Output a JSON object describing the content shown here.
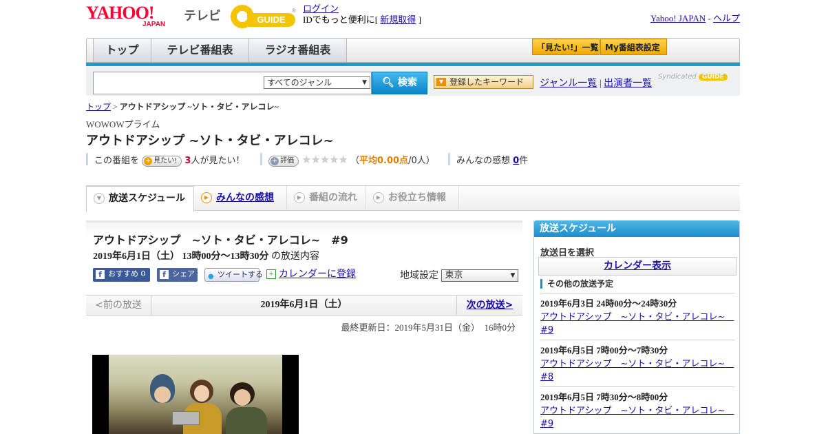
{
  "header": {
    "yahoo_logo": "YAHOO!",
    "yahoo_japan": "JAPAN",
    "tv_label": "テレビ",
    "gguide_label": "GUIDE",
    "gguide_reg": "®",
    "login_link": "ログイン",
    "login_text": "IDでもっと便利に[",
    "signup_link": "新規取得",
    "login_close": "]",
    "yahoo_japan_link": "Yahoo! JAPAN",
    "help_sep": "-",
    "help_link": "ヘルプ"
  },
  "nav": {
    "tabs": [
      {
        "label": "トップ"
      },
      {
        "label": "テレビ番組表"
      },
      {
        "label": "ラジオ番組表"
      }
    ],
    "want_list_button": "「見たい!」一覧",
    "my_schedule_button": "My番組表設定"
  },
  "search": {
    "genre_selected": "すべてのジャンル",
    "button_label": "検索",
    "keyword_button": "登録したキーワード",
    "genre_list_link": "ジャンル一覧",
    "link_sep": "|",
    "performer_list_link": "出演者一覧",
    "syndicated_label": "Syndicated",
    "syndicated_brand": "GUIDE"
  },
  "breadcrumb": {
    "home": "トップ",
    "sep": ">",
    "current": "アウトドアシップ ~ソト・タビ・アレコレ~"
  },
  "program": {
    "channel": "WOWOWプライム",
    "title": "アウトドアシップ ~ソト・タビ・アレコレ~",
    "this_program": "この番組を",
    "want_button": "見たい!",
    "want_count": "3",
    "want_suffix": "人が見たい！",
    "rate_button": "評価",
    "stars": "★★★★★",
    "avg_open": "（",
    "avg_label": "平均0.00点",
    "avg_people": "/0人）",
    "impressions_label": "みんなの感想",
    "impressions_count": "0",
    "impressions_suffix": "件"
  },
  "content_tabs": [
    {
      "label": "放送スケジュール"
    },
    {
      "label": "みんなの感想"
    },
    {
      "label": "番組の流れ"
    },
    {
      "label": "お役立ち情報"
    }
  ],
  "episode": {
    "title": "アウトドアシップ　~ソト・タビ・アレコレ~　#9",
    "datetime": "2019年6月1日（土） 13時00分～13時30分",
    "datetime_suffix": "の放送内容",
    "fb_recommend": "おすすめ",
    "fb_count": "0",
    "fb_share": "シェア",
    "tweet": "ツイートする",
    "calendar": "カレンダーに登録",
    "region_label": "地域設定",
    "region_selected": "東京"
  },
  "pager": {
    "prev": "<前の放送",
    "current": "2019年6月1日（土）",
    "next": "次の放送>"
  },
  "updated": "最終更新日：2019年5月31日（金）　16時0分",
  "sidebar": {
    "heading": "放送スケジュール",
    "select_date": "放送日を選択",
    "calendar_button": "カレンダー表示",
    "other_schedule": "その他の放送予定",
    "items": [
      {
        "date": "2019年6月3日  24時00分～24時30分",
        "title": "アウトドアシップ　~ソト・タビ・アレコレ~　#9"
      },
      {
        "date": "2019年6月5日  7時00分～7時30分",
        "title": "アウトドアシップ　~ソト・タビ・アレコレ~　#8"
      },
      {
        "date": "2019年6月5日  7時30分～8時00分",
        "title": "アウトドアシップ　~ソト・タビ・アレコレ~　#9"
      }
    ]
  },
  "colors": {
    "accent_blue": "#1c9ad6",
    "yahoo_red": "#ff0033",
    "gguide_yellow": "#f5c400",
    "link": "#1a0dab"
  }
}
